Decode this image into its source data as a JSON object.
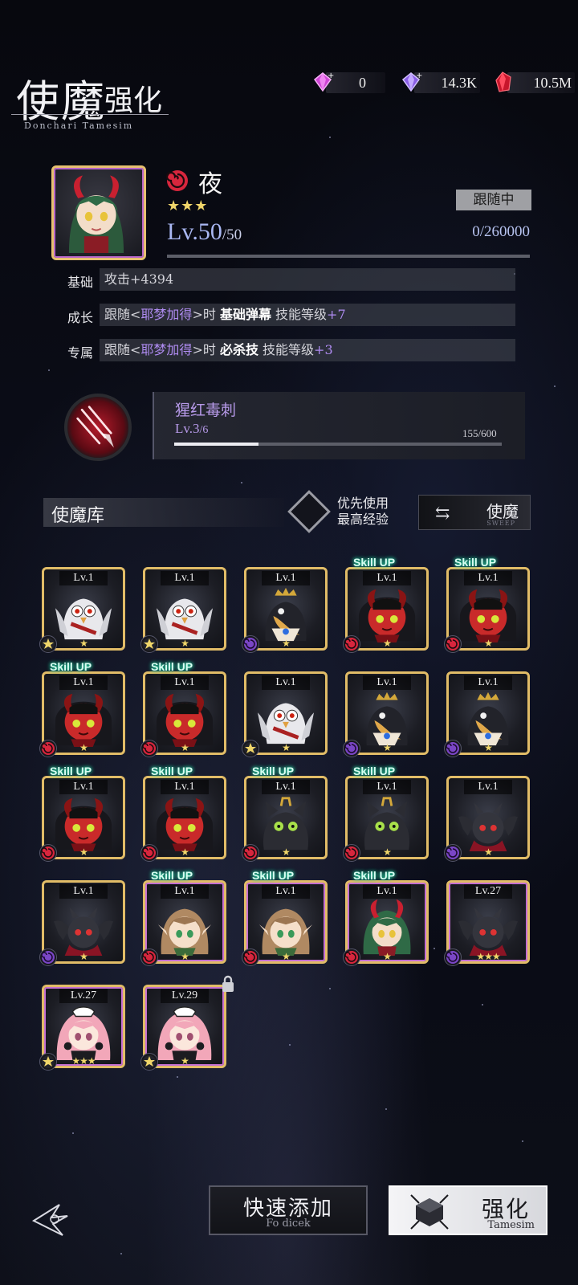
{
  "header": {
    "title_main": "使魔",
    "title_sub": "强化",
    "title_en": "Donchari Tamesim"
  },
  "currencies": [
    {
      "icon": "pink-gem-plus-icon",
      "value": "0"
    },
    {
      "icon": "purple-gem-plus-icon",
      "value": "14.3K"
    },
    {
      "icon": "red-crystal-icon",
      "value": "10.5M"
    }
  ],
  "selected": {
    "name": "夜",
    "stars": "★★★",
    "level": "Lv.50",
    "level_max": "/50",
    "status": "跟随中",
    "exp": "0/260000",
    "stats": [
      {
        "label": "基础",
        "parts": [
          "攻击+4394"
        ]
      },
      {
        "label": "成长",
        "parts": [
          "跟随<",
          "耶梦加得",
          ">时 ",
          "基础弹幕",
          " 技能等级",
          "+7"
        ]
      },
      {
        "label": "专属",
        "parts": [
          "跟随<",
          "耶梦加得",
          ">时 ",
          "必杀技",
          " 技能等级",
          "+3"
        ]
      }
    ]
  },
  "skill": {
    "name": "猩红毒刺",
    "level": "Lv.3",
    "level_max": "/6",
    "progress_text": "155/600",
    "progress_fraction": 0.258
  },
  "library": {
    "title": "使魔库",
    "pref_line1": "优先使用",
    "pref_line2": "最高经验",
    "sweep_label": "使魔",
    "sweep_sub": "SWEEP"
  },
  "cards": [
    {
      "lv": "Lv.1",
      "stars": "★",
      "elem": "star",
      "art": "owl",
      "skillup": false
    },
    {
      "lv": "Lv.1",
      "stars": "★",
      "elem": "star",
      "art": "owl",
      "skillup": false
    },
    {
      "lv": "Lv.1",
      "stars": "★",
      "elem": "purple",
      "art": "crow",
      "skillup": false
    },
    {
      "lv": "Lv.1",
      "stars": "★",
      "elem": "red",
      "art": "imp",
      "skillup": true
    },
    {
      "lv": "Lv.1",
      "stars": "★",
      "elem": "red",
      "art": "imp",
      "skillup": true
    },
    {
      "lv": "Lv.1",
      "stars": "★",
      "elem": "red",
      "art": "imp",
      "skillup": true
    },
    {
      "lv": "Lv.1",
      "stars": "★",
      "elem": "red",
      "art": "imp",
      "skillup": true
    },
    {
      "lv": "Lv.1",
      "stars": "★",
      "elem": "star",
      "art": "owl",
      "skillup": false
    },
    {
      "lv": "Lv.1",
      "stars": "★",
      "elem": "purple",
      "art": "crow",
      "skillup": false
    },
    {
      "lv": "Lv.1",
      "stars": "★",
      "elem": "purple",
      "art": "crow",
      "skillup": false
    },
    {
      "lv": "Lv.1",
      "stars": "★",
      "elem": "red",
      "art": "imp",
      "skillup": true
    },
    {
      "lv": "Lv.1",
      "stars": "★",
      "elem": "red",
      "art": "imp",
      "skillup": true
    },
    {
      "lv": "Lv.1",
      "stars": "★",
      "elem": "red",
      "art": "cat",
      "skillup": true
    },
    {
      "lv": "Lv.1",
      "stars": "★",
      "elem": "red",
      "art": "cat",
      "skillup": true
    },
    {
      "lv": "Lv.1",
      "stars": "★",
      "elem": "purple",
      "art": "bat",
      "skillup": false
    },
    {
      "lv": "Lv.1",
      "stars": "★",
      "elem": "purple",
      "art": "bat",
      "skillup": false
    },
    {
      "lv": "Lv.1",
      "stars": "★",
      "elem": "red",
      "art": "elf",
      "skillup": true,
      "rarity": "purple"
    },
    {
      "lv": "Lv.1",
      "stars": "★",
      "elem": "red",
      "art": "elf",
      "skillup": true,
      "rarity": "purple"
    },
    {
      "lv": "Lv.1",
      "stars": "★",
      "elem": "red",
      "art": "demon-girl",
      "skillup": true,
      "rarity": "purple"
    },
    {
      "lv": "Lv.27",
      "stars": "★★★",
      "elem": "purple",
      "art": "bat",
      "skillup": false,
      "rarity": "purple"
    },
    {
      "lv": "Lv.27",
      "stars": "★★★",
      "elem": "star",
      "art": "maid",
      "skillup": false,
      "rarity": "purple"
    },
    {
      "lv": "Lv.29",
      "stars": "★",
      "elem": "star",
      "art": "maid",
      "skillup": false,
      "rarity": "purple",
      "locked": true
    }
  ],
  "skillup_text": "Skill UP",
  "bottom": {
    "quick_label": "快速添加",
    "quick_sub": "Fo dicek",
    "enhance_label": "强化",
    "enhance_sub": "Tamesim"
  },
  "colors": {
    "accent_purple": "#b08cf2",
    "gold_frame": "#e1bc67",
    "skill_up_glow": "#27d7a5",
    "element_red": "#d7263d",
    "element_purple": "#7a46c6"
  }
}
